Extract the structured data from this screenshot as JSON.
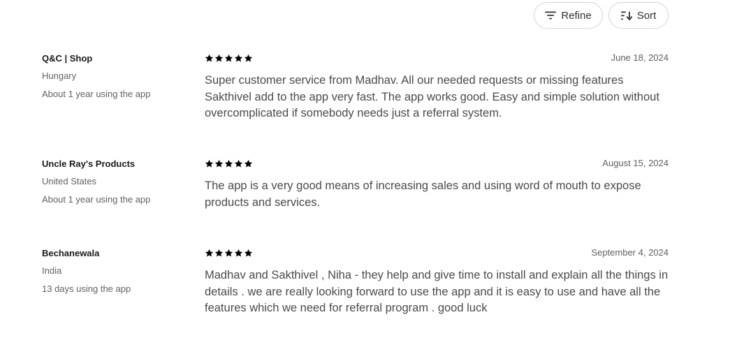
{
  "toolbar": {
    "refine_label": "Refine",
    "sort_label": "Sort"
  },
  "reviews": [
    {
      "reviewer": "Q&C | Shop",
      "country": "Hungary",
      "usage": "About 1 year using the app",
      "rating": 5,
      "date": "June 18, 2024",
      "text": "Super customer service from Madhav. All our needed requests or missing features Sakthivel add to the app very fast. The app works good. Easy and simple solution without overcomplicated if somebody needs just a referral system."
    },
    {
      "reviewer": "Uncle Ray's Products",
      "country": "United States",
      "usage": "About 1 year using the app",
      "rating": 5,
      "date": "August 15, 2024",
      "text": "The app is a very good means of increasing sales and using word of mouth to expose products and services."
    },
    {
      "reviewer": "Bechanewala",
      "country": "India",
      "usage": "13 days using the app",
      "rating": 5,
      "date": "September 4, 2024",
      "text": "Madhav and Sakthivel , Niha - they help and give time to install and explain all the things in details . we are really looking forward to use the app and it is easy to use and have all the features which we need for referral program . good luck"
    }
  ],
  "icons": {
    "refine": "filter-lines-icon",
    "sort": "sort-arrows-icon",
    "star": "star-filled-icon"
  },
  "colors": {
    "star": "#000000",
    "text": "#4a4a4a",
    "muted": "#616161",
    "border": "#d4d4d4"
  }
}
